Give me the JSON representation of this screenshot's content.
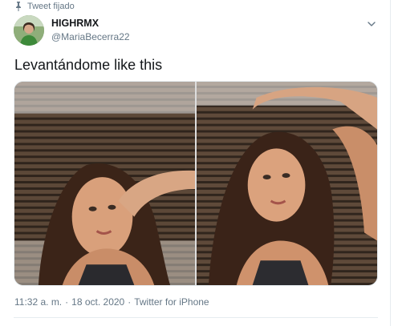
{
  "header": {
    "pinned_label": "Tweet fijado",
    "display_name": "HIGHRMX",
    "handle": "@MariaBecerra22"
  },
  "tweet": {
    "text": "Levantándome like this",
    "photos": [
      {
        "alt_name": "photo-1"
      },
      {
        "alt_name": "photo-2"
      }
    ]
  },
  "meta": {
    "time": "11:32 a. m.",
    "sep1": "·",
    "date": "18 oct. 2020",
    "sep2": "·",
    "source": "Twitter for iPhone"
  },
  "colors": {
    "secondary_text": "#657786",
    "primary_text": "#14171a",
    "border": "#e6ecf0"
  },
  "icons": {
    "pin": "pin-icon",
    "caret": "chevron-down-icon"
  }
}
